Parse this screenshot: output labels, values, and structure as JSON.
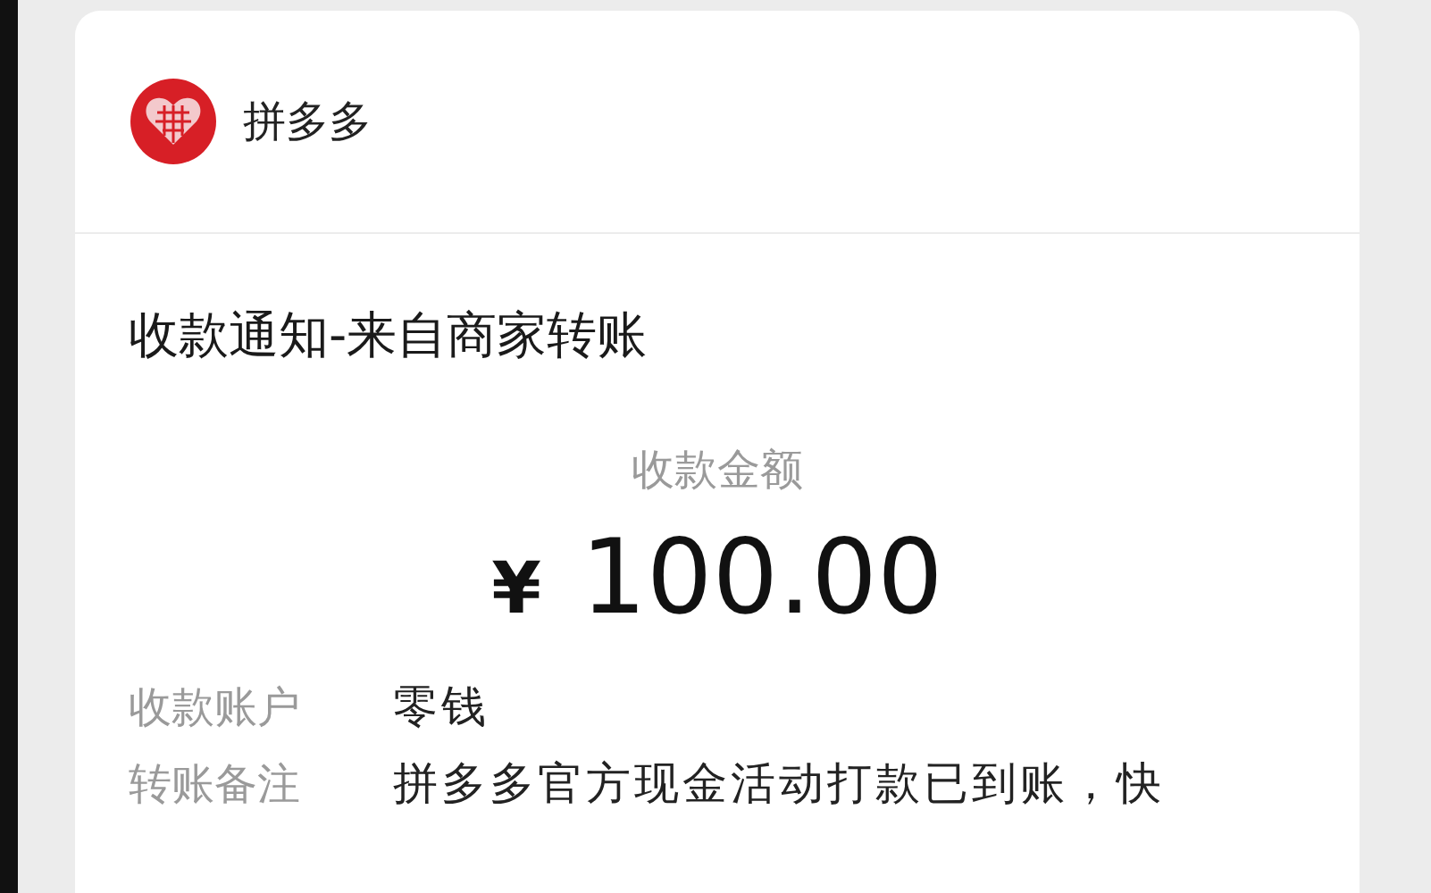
{
  "app": {
    "name": "拼多多"
  },
  "notice": {
    "title": "收款通知-来自商家转账",
    "amount_label": "收款金额",
    "currency": "¥",
    "amount": "100.00"
  },
  "details": [
    {
      "label": "收款账户",
      "value": "零钱"
    },
    {
      "label": "转账备注",
      "value": "拼多多官方现金活动打款已到账，快"
    }
  ]
}
